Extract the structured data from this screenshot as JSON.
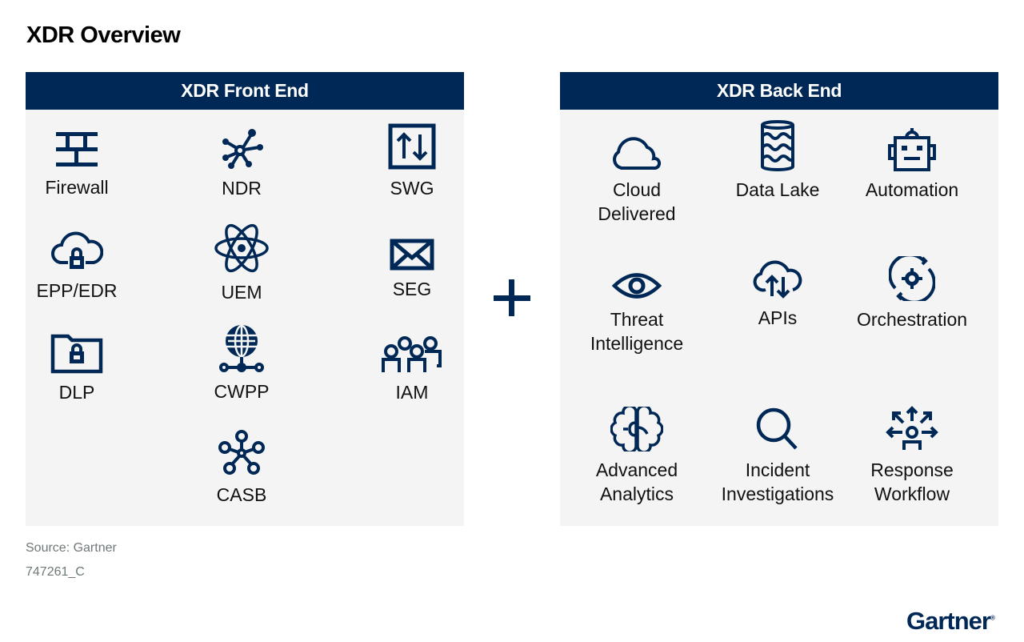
{
  "title": "XDR Overview",
  "front_end": {
    "header": "XDR Front End",
    "items": [
      {
        "label": "Firewall",
        "icon": "firewall-icon"
      },
      {
        "label": "NDR",
        "icon": "network-hub-icon"
      },
      {
        "label": "SWG",
        "icon": "upload-download-box-icon"
      },
      {
        "label": "EPP/EDR",
        "icon": "cloud-lock-icon"
      },
      {
        "label": "UEM",
        "icon": "atom-icon"
      },
      {
        "label": "SEG",
        "icon": "envelope-icon"
      },
      {
        "label": "DLP",
        "icon": "folder-lock-icon"
      },
      {
        "label": "CWPP",
        "icon": "globe-network-icon"
      },
      {
        "label": "IAM",
        "icon": "people-group-icon"
      },
      {
        "label": "CASB",
        "icon": "node-cluster-icon"
      }
    ]
  },
  "connector": {
    "symbol": "plus-icon"
  },
  "back_end": {
    "header": "XDR Back End",
    "items": [
      {
        "label_line1": "Cloud",
        "label_line2": "Delivered",
        "icon": "cloud-icon"
      },
      {
        "label_line1": "Data Lake",
        "label_line2": "",
        "icon": "data-lake-icon"
      },
      {
        "label_line1": "Automation",
        "label_line2": "",
        "icon": "robot-icon"
      },
      {
        "label_line1": "Threat",
        "label_line2": "Intelligence",
        "icon": "eye-icon"
      },
      {
        "label_line1": "APIs",
        "label_line2": "",
        "icon": "cloud-sync-icon"
      },
      {
        "label_line1": "Orchestration",
        "label_line2": "",
        "icon": "gear-cycle-icon"
      },
      {
        "label_line1": "Advanced",
        "label_line2": "Analytics",
        "icon": "brain-icon"
      },
      {
        "label_line1": "Incident",
        "label_line2": "Investigations",
        "icon": "magnifier-icon"
      },
      {
        "label_line1": "Response",
        "label_line2": "Workflow",
        "icon": "person-arrows-icon"
      }
    ]
  },
  "footer": {
    "source": "Source: Gartner",
    "doc_id": "747261_C",
    "logo": "Gartner",
    "logo_mark": "®"
  },
  "colors": {
    "primary": "#002856",
    "panel_bg": "#f4f4f4",
    "footnote": "#6f7878"
  }
}
